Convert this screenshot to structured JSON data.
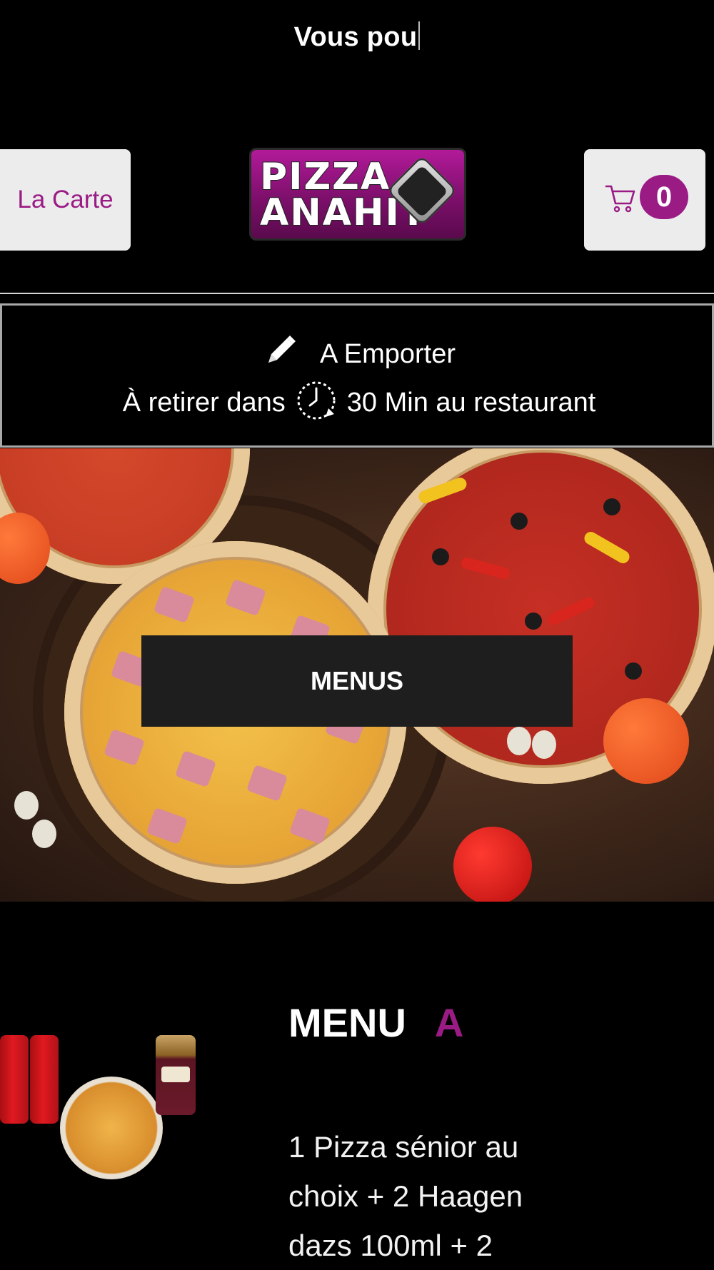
{
  "typing_text": "Vous pou",
  "header": {
    "carte_label": "La Carte",
    "cart_count": "0",
    "logo_text_line1": "PIZZA",
    "logo_text_line2": "ANAHIT"
  },
  "order": {
    "mode_label": "A Emporter",
    "pickup_prefix": "À retirer dans",
    "pickup_suffix": "30 Min au restaurant"
  },
  "hero": {
    "button_label": "MENUS"
  },
  "menu_item": {
    "title": "MENU",
    "letter": "A",
    "description": "1 Pizza sénior au choix + 2 Haagen dazs 100ml + 2"
  },
  "colors": {
    "accent": "#9b1b85",
    "button_bg": "#ececec",
    "page_bg": "#000000"
  },
  "icons": [
    "cart-icon",
    "pencil-icon",
    "clock-icon"
  ]
}
